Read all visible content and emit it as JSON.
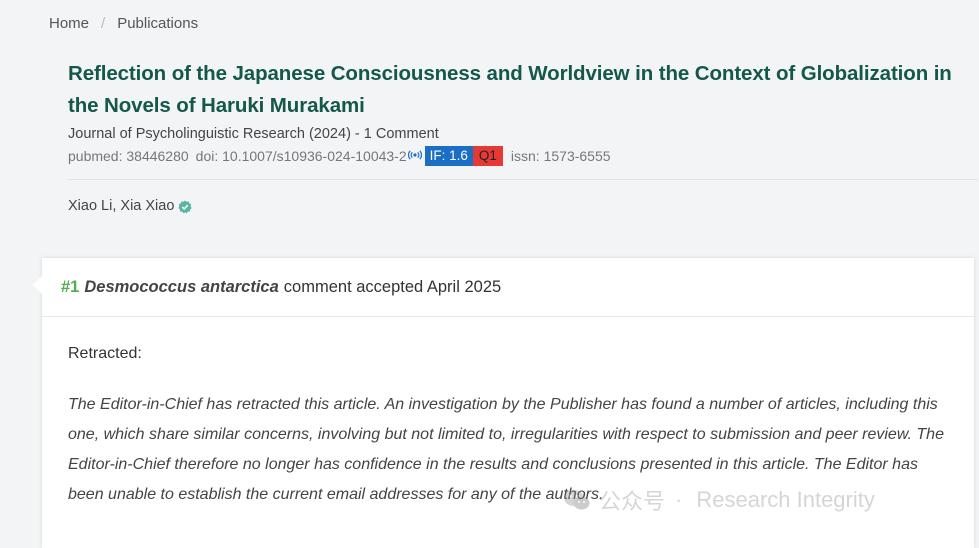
{
  "breadcrumb": {
    "home": "Home",
    "separator": "/",
    "current": "Publications"
  },
  "article": {
    "title": "Reflection of the Japanese Consciousness and Worldview in the Context of Globalization in the Novels of Haruki Murakami",
    "journal": "Journal of Psycholinguistic Research (2024)",
    "journal_sep": " - ",
    "comment_count": "1 Comment",
    "pubmed": "pubmed: 38446280",
    "doi": "doi: 10.1007/s10936-024-10043-2",
    "impact_factor": "IF: 1.6",
    "quartile": "Q1",
    "issn": "issn: 1573-6555",
    "authors": "Xiao Li, Xia Xiao"
  },
  "comment": {
    "number": "#1",
    "species": "Desmococcus antarctica",
    "status": "comment accepted April 2025",
    "label": "Retracted:",
    "body": "The Editor-in-Chief has retracted this article. An investigation by the Publisher has found a number of articles, including this one, which share similar concerns, involving but not limited to, irregularities with respect to submission and peer review. The Editor-in-Chief therefore no longer has confidence in the results and conclusions presented in this article. The Editor has been unable to establish the current email addresses for any of the authors."
  },
  "watermark": {
    "text_cn": "公众号",
    "separator": "·",
    "text": "Research Integrity"
  },
  "colors": {
    "title": "#14574b",
    "if_badge": "#1a6fc4",
    "quartile_badge": "#e53935",
    "comment_number": "#4caf50",
    "verified": "#5ab5a5"
  },
  "icons": {
    "doi_link": "broadcast-icon",
    "verified": "verified-check-icon",
    "watermark_logo": "wechat-icon"
  }
}
